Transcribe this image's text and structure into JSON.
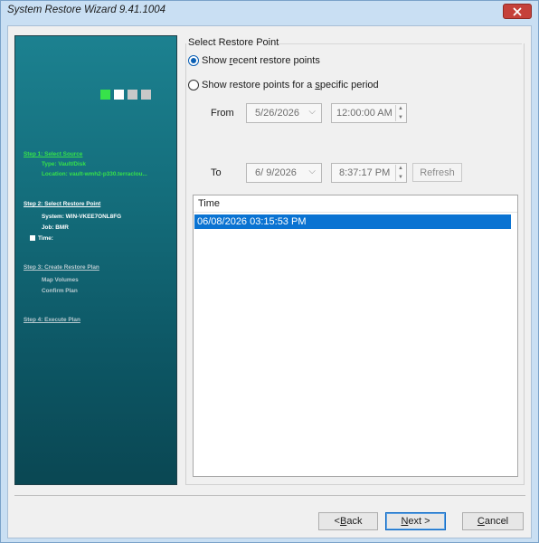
{
  "window": {
    "title": "System Restore Wizard 9.41.1004",
    "close_glyph": "✕"
  },
  "colors": {
    "panel_top": "#1c8190",
    "panel_bottom": "#0a4753",
    "active_green": "#37e24a",
    "selection_blue": "#0a73d2",
    "close_red": "#c5413a"
  },
  "progress_squares": [
    "#37e24a",
    "#ffffff",
    "#c8c8c8",
    "#c8c8c8"
  ],
  "steps": {
    "step1": {
      "title": "Step 1: Select Source",
      "items": [
        "Type: Vault/Disk",
        "Location: vault-wmh2-p330.terraclou..."
      ]
    },
    "step2": {
      "title": "Step 2: Select Restore Point",
      "items": [
        "System: WIN-VKEE7ONL8FG",
        "Job: BMR",
        "Time:"
      ]
    },
    "step3": {
      "title": "Step 3: Create Restore Plan",
      "items": [
        "Map Volumes",
        "Confirm Plan"
      ]
    },
    "step4": {
      "title": "Step 4: Execute Plan"
    }
  },
  "restore_point": {
    "group_label": "Select Restore Point",
    "radio_recent": {
      "pre": "Show ",
      "accel": "r",
      "post": "ecent restore points",
      "selected": true
    },
    "radio_period": {
      "pre": "Show restore points for a ",
      "accel": "s",
      "post": "pecific period",
      "selected": false
    },
    "from_label": "From",
    "to_label": "To",
    "from_date": "5/26/2026",
    "from_time": "12:00:00 AM",
    "to_date": "6/ 9/2026",
    "to_time": "8:37:17 PM",
    "refresh_label": "Refresh",
    "chevron_glyph": "⌵",
    "spin_up": "▲",
    "spin_down": "▼",
    "list_header": "Time",
    "list_rows": [
      "06/08/2026 03:15:53 PM"
    ]
  },
  "buttons": {
    "back": {
      "pre": "< ",
      "accel": "B",
      "post": "ack"
    },
    "next": {
      "pre": "",
      "accel": "N",
      "post": "ext >"
    },
    "cancel": {
      "pre": "",
      "accel": "C",
      "post": "ancel"
    }
  }
}
